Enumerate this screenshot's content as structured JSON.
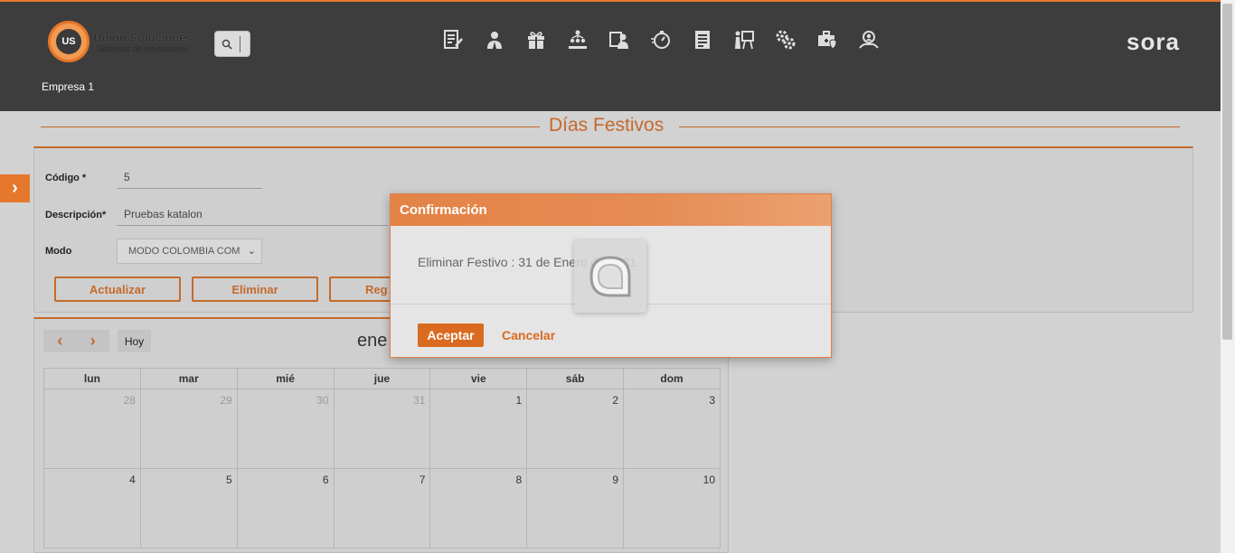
{
  "header": {
    "logo_title": "Unión Soluciones",
    "logo_subtitle": "Sistemas de Información",
    "logo_mark": "US",
    "brand": "sora",
    "company": "Empresa 1",
    "nav_icons": [
      "document-edit-icon",
      "user-tie-icon",
      "gift-icon",
      "org-chart-icon",
      "team-id-icon",
      "stopwatch-icon",
      "report-icon",
      "presentation-icon",
      "gears-icon",
      "medical-kit-icon",
      "user-search-icon"
    ]
  },
  "page": {
    "title": "Días Festivos"
  },
  "form": {
    "codigo_label": "Código *",
    "codigo_value": "5",
    "descripcion_label": "Descripción*",
    "descripcion_value": "Pruebas katalon",
    "modo_label": "Modo",
    "modo_value": "MODO COLOMBIA COM",
    "btn_actualizar": "Actualizar",
    "btn_eliminar": "Eliminar",
    "btn_regresar": "Reg"
  },
  "calendar": {
    "today_label": "Hoy",
    "month_label": "ene",
    "weekdays": [
      "lun",
      "mar",
      "mié",
      "jue",
      "vie",
      "sáb",
      "dom"
    ],
    "weeks": [
      [
        {
          "d": "28",
          "other": true
        },
        {
          "d": "29",
          "other": true
        },
        {
          "d": "30",
          "other": true
        },
        {
          "d": "31",
          "other": true
        },
        {
          "d": "1"
        },
        {
          "d": "2"
        },
        {
          "d": "3"
        }
      ],
      [
        {
          "d": "4"
        },
        {
          "d": "5"
        },
        {
          "d": "6"
        },
        {
          "d": "7"
        },
        {
          "d": "8"
        },
        {
          "d": "9"
        },
        {
          "d": "10"
        }
      ]
    ]
  },
  "modal": {
    "title": "Confirmación",
    "message": "Eliminar Festivo : 31 de Enero de 2021",
    "accept": "Aceptar",
    "cancel": "Cancelar"
  },
  "colors": {
    "accent": "#c46a2c",
    "header_bg": "#3d3d3d",
    "button_primary": "#d96a1f"
  }
}
